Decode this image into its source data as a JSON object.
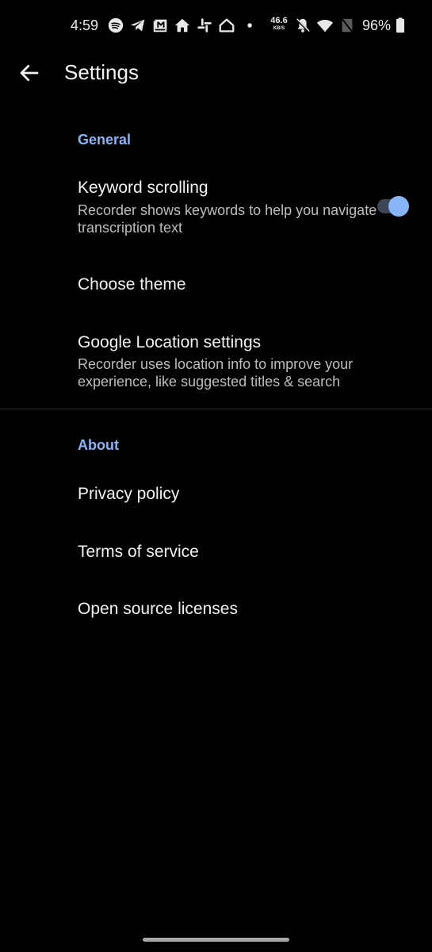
{
  "status_bar": {
    "time": "4:59",
    "notification_icons": [
      "spotify-icon",
      "telegram-icon",
      "gmail-icon",
      "home-icon",
      "slack-icon",
      "google-home-icon",
      "more-dot-icon"
    ],
    "network_speed_value": "46.6",
    "network_speed_unit": "KB/S",
    "system_icons": [
      "bell-off-icon",
      "wifi-icon",
      "no-sim-icon"
    ],
    "battery_percent": "96%"
  },
  "app_bar": {
    "title": "Settings"
  },
  "sections": [
    {
      "header": "General",
      "items": [
        {
          "title": "Keyword scrolling",
          "subtitle": "Recorder shows keywords to help you navigate transcription text",
          "toggle": true,
          "enabled": true
        },
        {
          "title": "Choose theme"
        },
        {
          "title": "Google Location settings",
          "subtitle": "Recorder uses location info to improve your experience, like suggested titles & search"
        }
      ]
    },
    {
      "header": "About",
      "items": [
        {
          "title": "Privacy policy"
        },
        {
          "title": "Terms of service"
        },
        {
          "title": "Open source licenses"
        }
      ]
    }
  ],
  "colors": {
    "accent": "#8ab4f8",
    "background": "#000000",
    "switch_track": "#3c4657"
  }
}
